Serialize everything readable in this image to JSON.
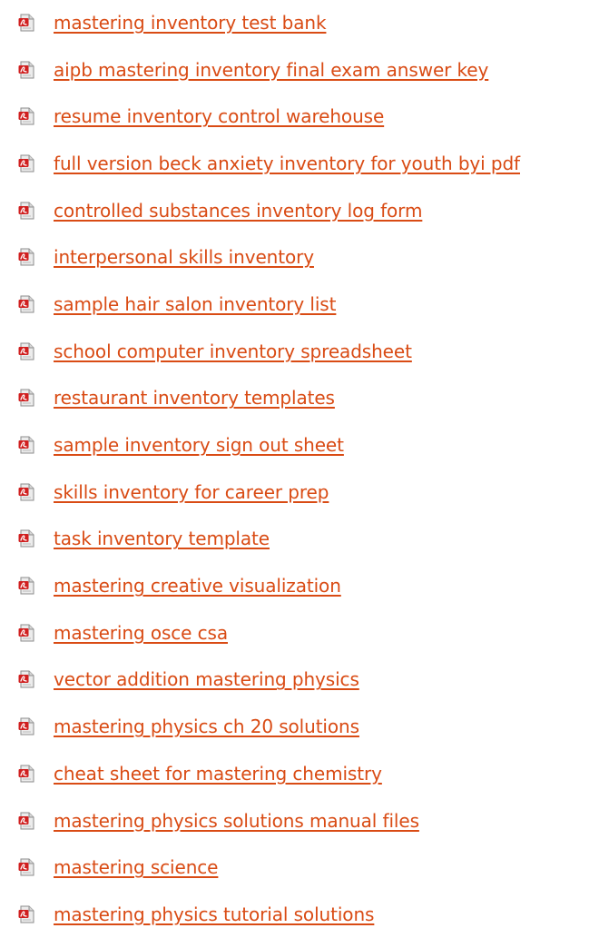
{
  "colors": {
    "link": "#d94b14",
    "icon_red": "#d01f1f",
    "icon_paper": "#eaeaea"
  },
  "icon": "pdf-file-icon",
  "links": [
    "mastering inventory test bank",
    "aipb mastering inventory final exam answer key",
    "resume inventory control warehouse",
    "full version beck anxiety inventory for youth byi pdf",
    "controlled substances inventory log form",
    "interpersonal skills inventory",
    "sample hair salon inventory list",
    "school computer inventory spreadsheet",
    "restaurant inventory templates",
    "sample inventory sign out sheet",
    "skills inventory for career prep",
    "task inventory template",
    "mastering creative visualization",
    "mastering osce csa",
    "vector addition mastering physics",
    "mastering physics ch 20 solutions",
    "cheat sheet for mastering chemistry",
    "mastering physics solutions manual files",
    "mastering science",
    "mastering physics tutorial solutions"
  ]
}
